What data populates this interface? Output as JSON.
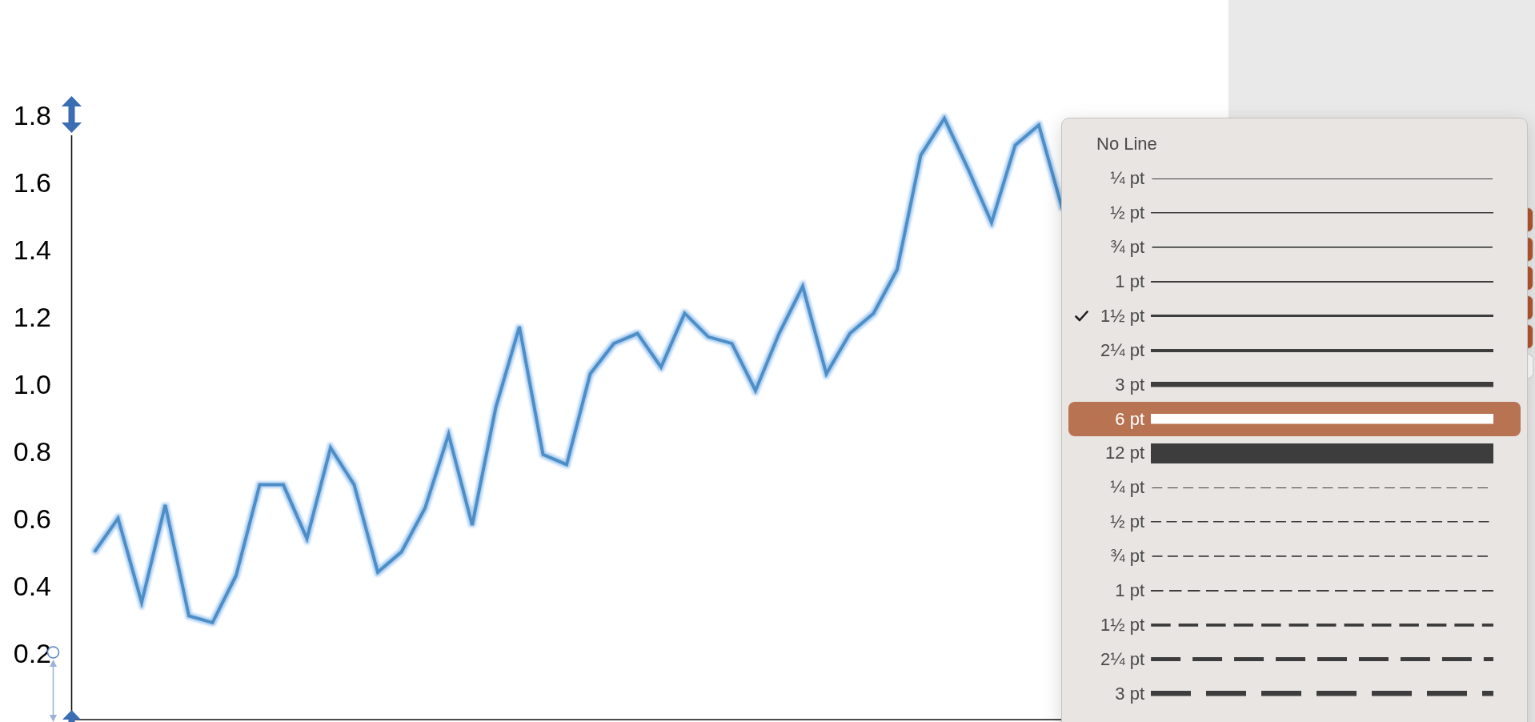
{
  "chart": {
    "chart_data": {
      "type": "line",
      "ylim": [
        0,
        1.8
      ],
      "yticks": [
        {
          "value": 0.2,
          "label": "0.2"
        },
        {
          "value": 0.4,
          "label": "0.4"
        },
        {
          "value": 0.6,
          "label": "0.6"
        },
        {
          "value": 0.8,
          "label": "0.8"
        },
        {
          "value": 1,
          "label": "1.0"
        },
        {
          "value": 1.2,
          "label": "1.2"
        },
        {
          "value": 1.4,
          "label": "1.4"
        },
        {
          "value": 1.6,
          "label": "1.6"
        },
        {
          "value": 1.8,
          "label": "1.8"
        }
      ],
      "series": [
        {
          "color": "#4d8ec6",
          "values": [
            0.5,
            0.6,
            0.35,
            0.64,
            0.31,
            0.29,
            0.43,
            0.7,
            0.7,
            0.54,
            0.81,
            0.7,
            0.44,
            0.5,
            0.63,
            0.85,
            0.58,
            0.93,
            1.17,
            0.79,
            0.76,
            1.03,
            1.12,
            1.15,
            1.05,
            1.21,
            1.14,
            1.12,
            0.98,
            1.15,
            1.29,
            1.03,
            1.15,
            1.21,
            1.34,
            1.68,
            1.79,
            1.64,
            1.48,
            1.71,
            1.77,
            1.52
          ]
        }
      ]
    }
  },
  "line_menu": {
    "items": [
      {
        "label": "No Line",
        "kind": "none",
        "checked": false,
        "selected": false
      },
      {
        "label": "¼ pt",
        "kind": "solid",
        "checked": false,
        "selected": false
      },
      {
        "label": "½ pt",
        "kind": "solid",
        "checked": false,
        "selected": false
      },
      {
        "label": "¾ pt",
        "kind": "solid",
        "checked": false,
        "selected": false
      },
      {
        "label": "1 pt",
        "kind": "solid",
        "checked": false,
        "selected": false
      },
      {
        "label": "1½ pt",
        "kind": "solid",
        "checked": true,
        "selected": false
      },
      {
        "label": "2¼ pt",
        "kind": "solid",
        "checked": false,
        "selected": false
      },
      {
        "label": "3 pt",
        "kind": "solid",
        "checked": false,
        "selected": false
      },
      {
        "label": "6 pt",
        "kind": "solid",
        "checked": false,
        "selected": true
      },
      {
        "label": "12 pt",
        "kind": "solid",
        "checked": false,
        "selected": false
      },
      {
        "label": "¼ pt",
        "kind": "dashed",
        "checked": false,
        "selected": false
      },
      {
        "label": "½ pt",
        "kind": "dashed",
        "checked": false,
        "selected": false
      },
      {
        "label": "¾ pt",
        "kind": "dashed",
        "checked": false,
        "selected": false
      },
      {
        "label": "1 pt",
        "kind": "dashed",
        "checked": false,
        "selected": false
      },
      {
        "label": "1½ pt",
        "kind": "dashed",
        "checked": false,
        "selected": false
      },
      {
        "label": "2¼ pt",
        "kind": "dashed",
        "checked": false,
        "selected": false
      },
      {
        "label": "3 pt",
        "kind": "dashed",
        "checked": false,
        "selected": false
      }
    ]
  },
  "inspector": {
    "swatches": [
      {
        "color": "#b5552e"
      },
      {
        "color": "#b5552e"
      },
      {
        "color": "#b5552e"
      },
      {
        "color": "#b5552e"
      },
      {
        "color": "#b5552e"
      },
      {
        "color": "#ffffff"
      }
    ]
  }
}
